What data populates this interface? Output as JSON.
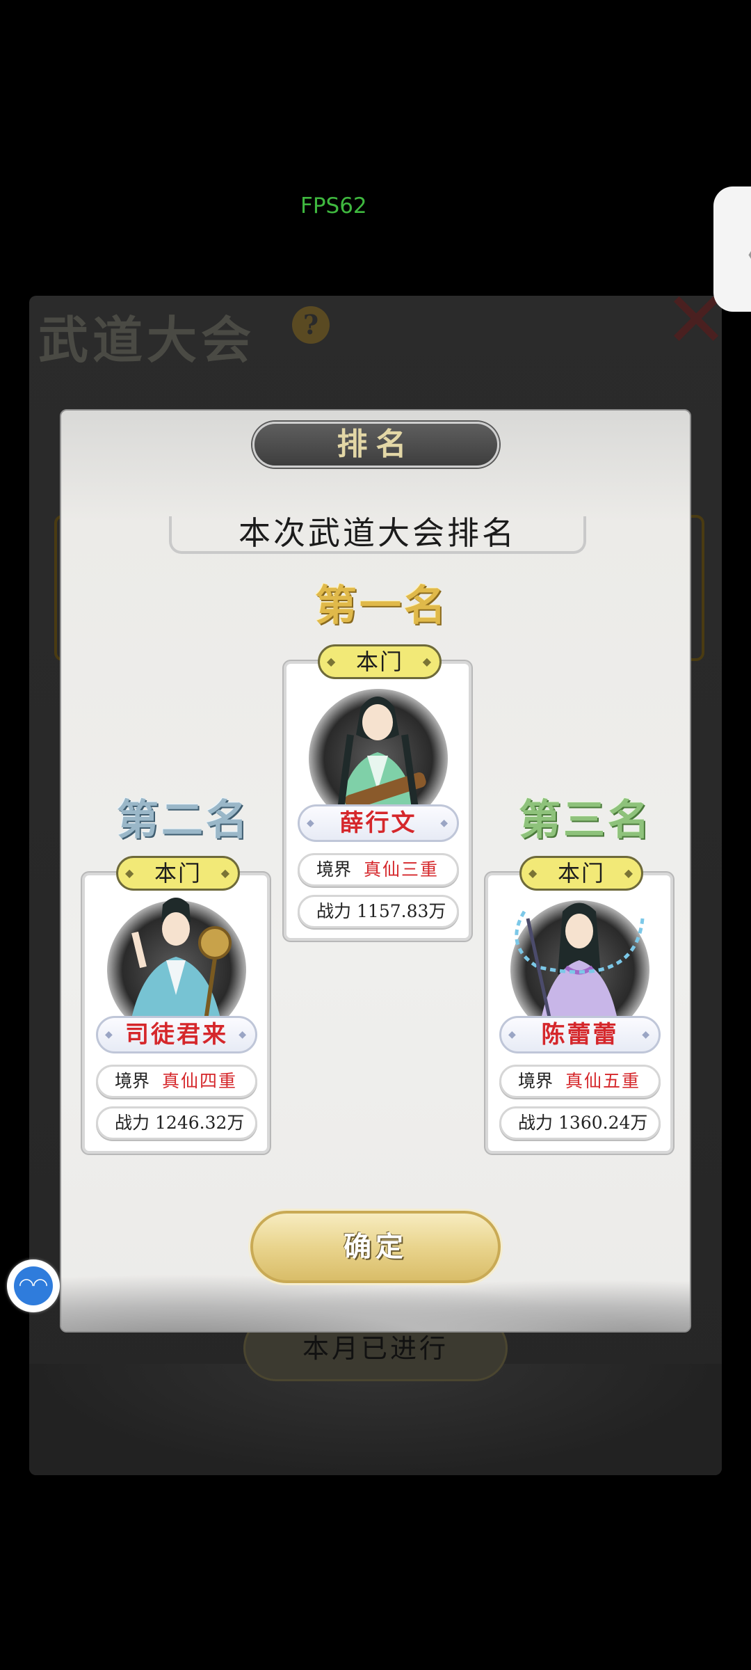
{
  "overlay": {
    "fps": "FPS62"
  },
  "background": {
    "title": "武道大会",
    "help_glyph": "?",
    "close_glyph": "✕",
    "month_button": "本月已进行",
    "side_handle_glyph": "〈"
  },
  "dialog": {
    "title": "排名",
    "banner": "本次武道大会排名",
    "confirm_label": "确定",
    "ranks": {
      "first": {
        "label": "第一名",
        "sect": "本门",
        "name": "薛行文",
        "realm_label": "境界",
        "realm": "真仙三重",
        "power_label": "战力",
        "power": "1157.83万",
        "robe_color": "#7fd0a8"
      },
      "second": {
        "label": "第二名",
        "sect": "本门",
        "name": "司徒君来",
        "realm_label": "境界",
        "realm": "真仙四重",
        "power_label": "战力",
        "power": "1246.32万",
        "robe_color": "#77c3d3"
      },
      "third": {
        "label": "第三名",
        "sect": "本门",
        "name": "陈蕾蕾",
        "realm_label": "境界",
        "realm": "真仙五重",
        "power_label": "战力",
        "power": "1360.24万",
        "robe_color": "#c8b6e8"
      }
    }
  },
  "float_ball": {
    "glyph": "◠◠"
  },
  "colors": {
    "gold": "#e0b94a",
    "silver": "#9ab7c8",
    "bronze": "#8ec27b",
    "name_red": "#d5272b",
    "badge_yellow": "#f2e977"
  }
}
